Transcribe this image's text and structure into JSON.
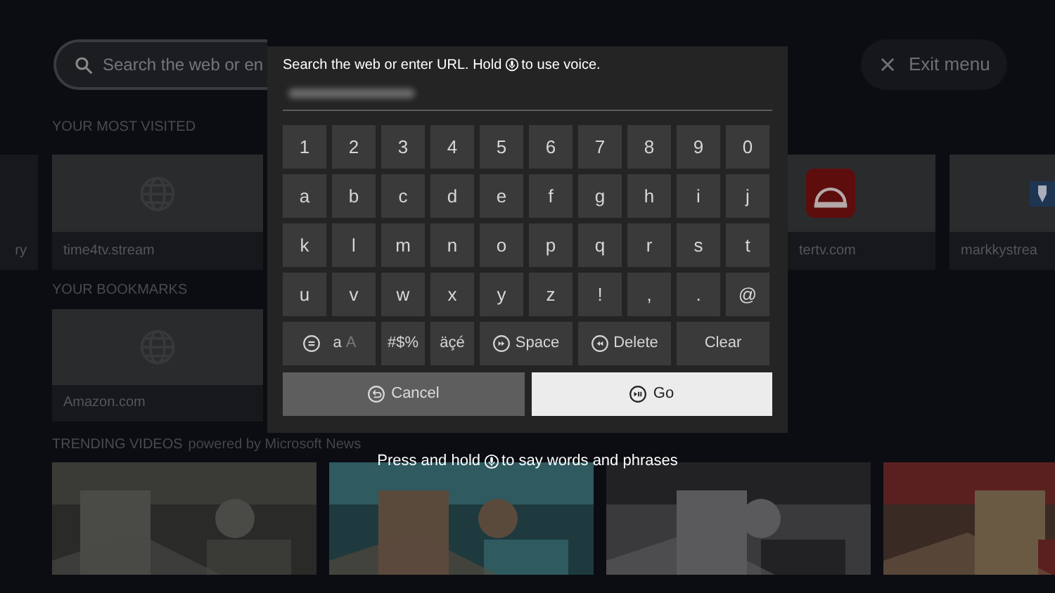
{
  "search_bar": {
    "placeholder": "Search the web or en"
  },
  "exit_button": {
    "label": "Exit menu"
  },
  "most_visited": {
    "title": "YOUR MOST VISITED",
    "tiles": [
      {
        "label": "ry",
        "kind": "edge"
      },
      {
        "label": "time4tv.stream",
        "kind": "globe"
      },
      {
        "label": "tertv.com",
        "kind": "red_logo"
      },
      {
        "label": "markkystrea",
        "kind": "blue_logo"
      }
    ]
  },
  "bookmarks": {
    "title": "YOUR BOOKMARKS",
    "tiles": [
      {
        "label": "Amazon.com",
        "kind": "globe"
      }
    ]
  },
  "trending": {
    "title": "TRENDING VIDEOS",
    "subtitle": "powered by Microsoft News"
  },
  "keyboard": {
    "hint_before": "Search the web or enter URL. Hold",
    "hint_after": "to use voice.",
    "rows": [
      [
        {
          "label": "1"
        },
        {
          "label": "2"
        },
        {
          "label": "3"
        },
        {
          "label": "4"
        },
        {
          "label": "5"
        },
        {
          "label": "6"
        },
        {
          "label": "7"
        },
        {
          "label": "8"
        },
        {
          "label": "9"
        },
        {
          "label": "0"
        }
      ],
      [
        {
          "label": "a"
        },
        {
          "label": "b"
        },
        {
          "label": "c"
        },
        {
          "label": "d"
        },
        {
          "label": "e"
        },
        {
          "label": "f"
        },
        {
          "label": "g"
        },
        {
          "label": "h"
        },
        {
          "label": "i"
        },
        {
          "label": "j"
        }
      ],
      [
        {
          "label": "k"
        },
        {
          "label": "l"
        },
        {
          "label": "m"
        },
        {
          "label": "n"
        },
        {
          "label": "o"
        },
        {
          "label": "p"
        },
        {
          "label": "q"
        },
        {
          "label": "r"
        },
        {
          "label": "s"
        },
        {
          "label": "t"
        }
      ],
      [
        {
          "label": "u"
        },
        {
          "label": "v"
        },
        {
          "label": "w"
        },
        {
          "label": "x"
        },
        {
          "label": "y"
        },
        {
          "label": "z"
        },
        {
          "label": "!"
        },
        {
          "label": ","
        },
        {
          "label": "."
        },
        {
          "label": "@"
        }
      ]
    ],
    "function_keys": [
      {
        "label": "a",
        "alt_label": "A",
        "kind": "case"
      },
      {
        "label": "#$%",
        "kind": "plain"
      },
      {
        "label": "äçé",
        "kind": "plain"
      },
      {
        "label": "Space",
        "kind": "space"
      },
      {
        "label": "Delete",
        "kind": "delete"
      },
      {
        "label": "Clear",
        "kind": "wide"
      }
    ],
    "actions": [
      {
        "label": "Cancel",
        "kind": "cancel",
        "selected": false
      },
      {
        "label": "Go",
        "kind": "go",
        "selected": true
      }
    ],
    "voice_hint_before": "Press and hold",
    "voice_hint_after": "to say words and phrases"
  }
}
